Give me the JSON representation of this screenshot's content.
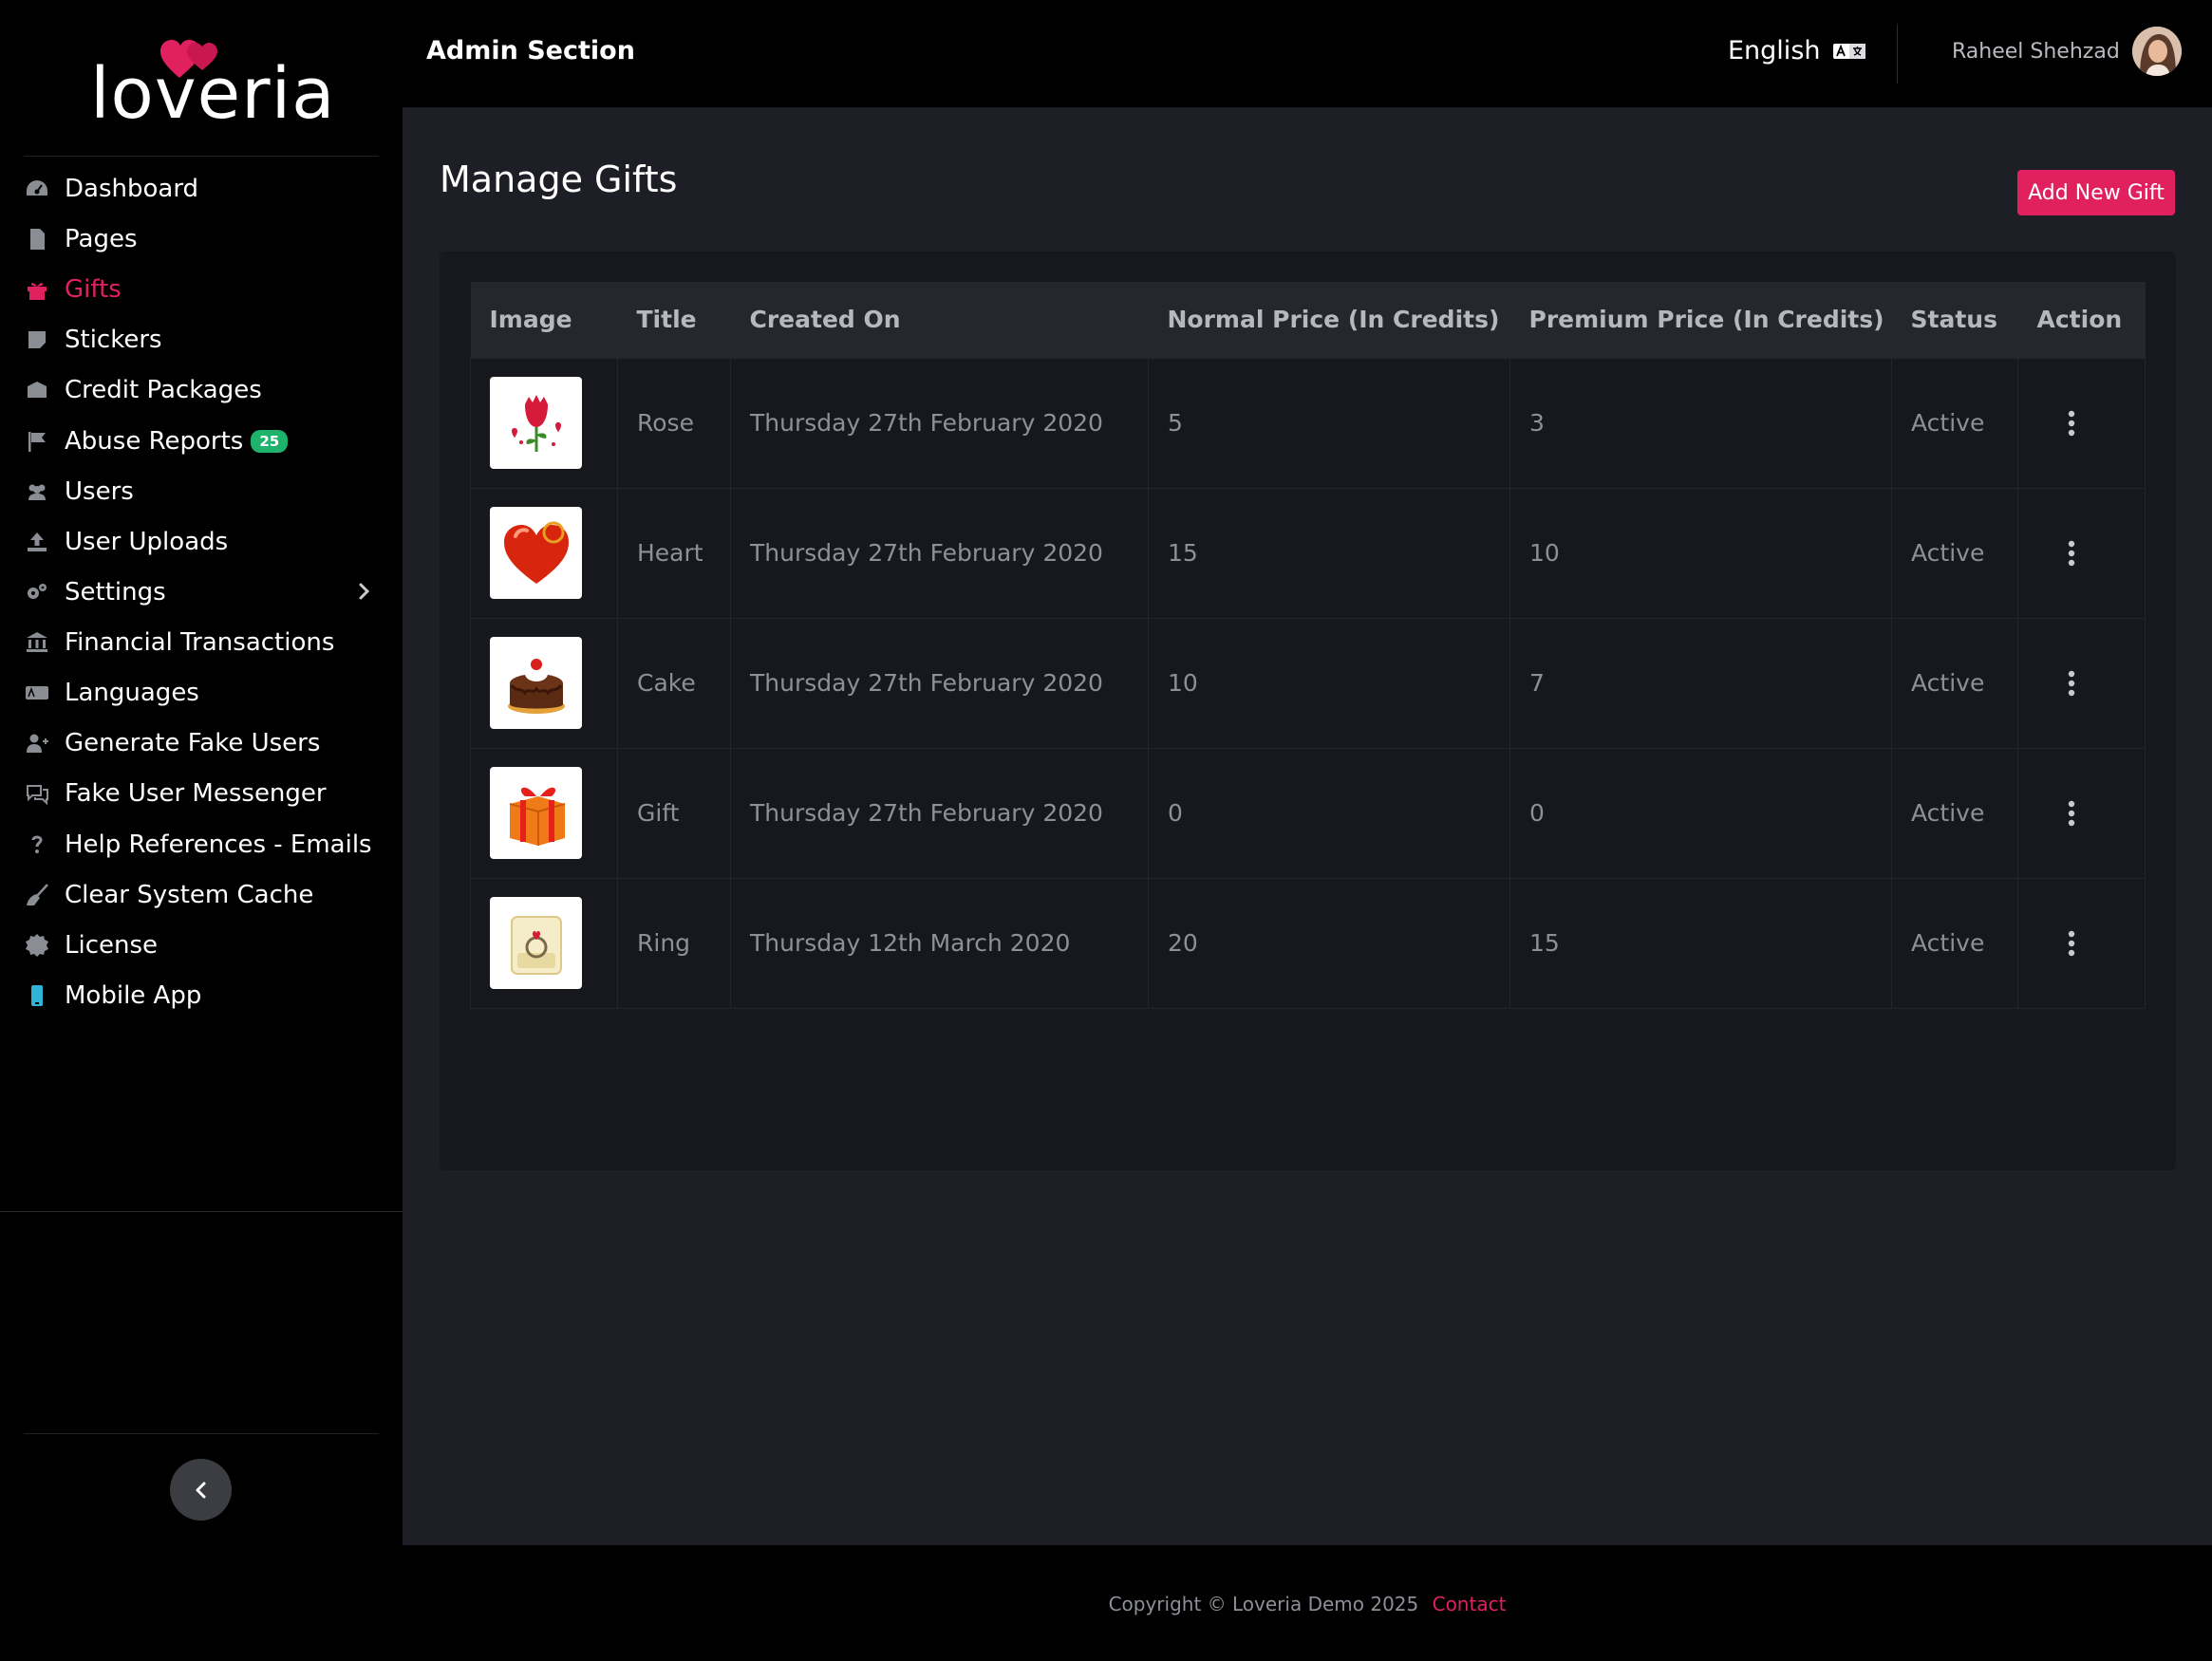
{
  "brand": {
    "logo_text": "loveria"
  },
  "sidebar": {
    "items": [
      {
        "label": "Dashboard",
        "icon": "dashboard-icon"
      },
      {
        "label": "Pages",
        "icon": "file-icon"
      },
      {
        "label": "Gifts",
        "icon": "gift-icon",
        "active": true
      },
      {
        "label": "Stickers",
        "icon": "sticky-note-icon"
      },
      {
        "label": "Credit Packages",
        "icon": "box-icon"
      },
      {
        "label": "Abuse Reports",
        "icon": "flag-icon",
        "badge": "25"
      },
      {
        "label": "Users",
        "icon": "users-icon"
      },
      {
        "label": "User Uploads",
        "icon": "upload-icon"
      },
      {
        "label": "Settings",
        "icon": "cogs-icon",
        "has_submenu": true
      },
      {
        "label": "Financial Transactions",
        "icon": "bank-icon"
      },
      {
        "label": "Languages",
        "icon": "language-icon"
      },
      {
        "label": "Generate Fake Users",
        "icon": "user-plus-icon"
      },
      {
        "label": "Fake User Messenger",
        "icon": "comments-icon"
      },
      {
        "label": "Help References - Emails",
        "icon": "question-icon"
      },
      {
        "label": "Clear System Cache",
        "icon": "broom-icon"
      },
      {
        "label": "License",
        "icon": "certificate-icon"
      },
      {
        "label": "Mobile App",
        "icon": "mobile-icon"
      }
    ]
  },
  "topbar": {
    "title": "Admin Section",
    "language": "English",
    "user_name": "Raheel Shehzad"
  },
  "main": {
    "title": "Manage Gifts",
    "add_button": "Add New Gift",
    "table": {
      "headers": [
        "Image",
        "Title",
        "Created On",
        "Normal Price (In Credits)",
        "Premium Price (In Credits)",
        "Status",
        "Action"
      ],
      "rows": [
        {
          "image": "rose-image",
          "title": "Rose",
          "created_on": "Thursday 27th February 2020",
          "normal_price": "5",
          "premium_price": "3",
          "status": "Active"
        },
        {
          "image": "heart-image",
          "title": "Heart",
          "created_on": "Thursday 27th February 2020",
          "normal_price": "15",
          "premium_price": "10",
          "status": "Active"
        },
        {
          "image": "cake-image",
          "title": "Cake",
          "created_on": "Thursday 27th February 2020",
          "normal_price": "10",
          "premium_price": "7",
          "status": "Active"
        },
        {
          "image": "gift-box-image",
          "title": "Gift",
          "created_on": "Thursday 27th February 2020",
          "normal_price": "0",
          "premium_price": "0",
          "status": "Active"
        },
        {
          "image": "ring-image",
          "title": "Ring",
          "created_on": "Thursday 12th March 2020",
          "normal_price": "20",
          "premium_price": "15",
          "status": "Active"
        }
      ]
    }
  },
  "footer": {
    "copyright": "Copyright © Loveria Demo 2025",
    "contact_link": "Contact"
  },
  "colors": {
    "accent": "#e0205f",
    "badge_green": "#1fb26d",
    "main_bg": "#1e1f26",
    "card_bg": "#17181d"
  }
}
